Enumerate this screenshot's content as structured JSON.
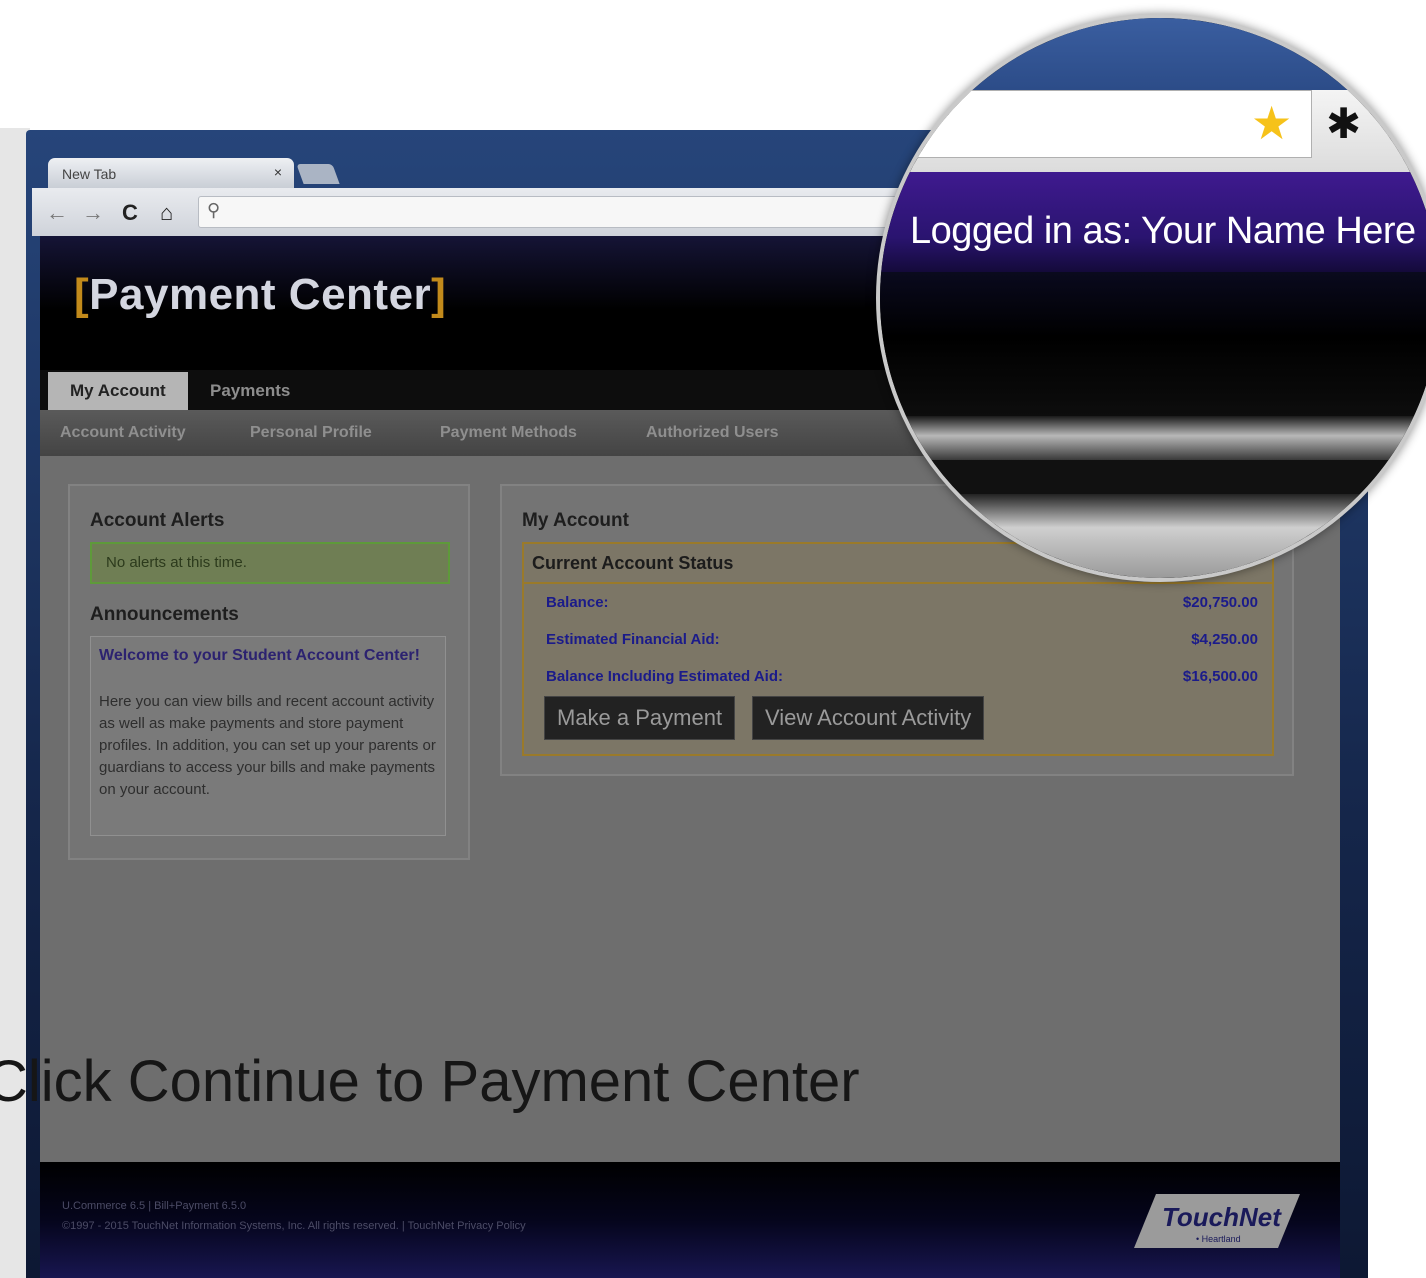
{
  "browser": {
    "tab_title": "New Tab",
    "tab_close": "×",
    "nav_back": "←",
    "nav_forward": "→",
    "nav_reload": "C",
    "nav_home": "⌂",
    "search_glyph": "⚲"
  },
  "app": {
    "bracket_open": "[",
    "title": "Payment Center",
    "bracket_close": "]",
    "accent_color": "#c28a1b",
    "user_label": "Logged in as: Your Name Here"
  },
  "main_tabs": [
    {
      "label": "My Account",
      "active": true
    },
    {
      "label": "Payments",
      "active": false
    }
  ],
  "sub_nav": [
    "Account Activity",
    "Personal Profile",
    "Payment Methods",
    "Authorized Users"
  ],
  "alerts": {
    "heading": "Account Alerts",
    "message": "No alerts at this time."
  },
  "announcements": {
    "heading": "Announcements",
    "title": "Welcome to your Student Account Center!",
    "body": "Here you can view bills and recent account activity as well as make payments and store payment profiles. In addition, you can set up your parents or guardians to access your bills and make payments on your account."
  },
  "account": {
    "heading": "My Account",
    "status_heading": "Current Account Status",
    "rows": [
      {
        "label": "Balance:",
        "value": "$20,750.00"
      },
      {
        "label": "Estimated Financial Aid:",
        "value": "$4,250.00"
      },
      {
        "label": "Balance Including Estimated Aid:",
        "value": "$16,500.00"
      }
    ],
    "buttons": {
      "make_payment": "Make a Payment",
      "view_activity": "View Account Activity"
    }
  },
  "instruction": "Click Continue to Payment Center",
  "footer": {
    "version": "U.Commerce 6.5 | Bill+Payment 6.5.0",
    "copyright": "©1997 - 2015 TouchNet Information Systems, Inc. All rights reserved. | TouchNet Privacy Policy"
  },
  "logo": {
    "name": "TouchNet",
    "subtitle": "• Heartland"
  },
  "zoom": {
    "star_glyph": "★",
    "gear_glyph": "✱"
  }
}
